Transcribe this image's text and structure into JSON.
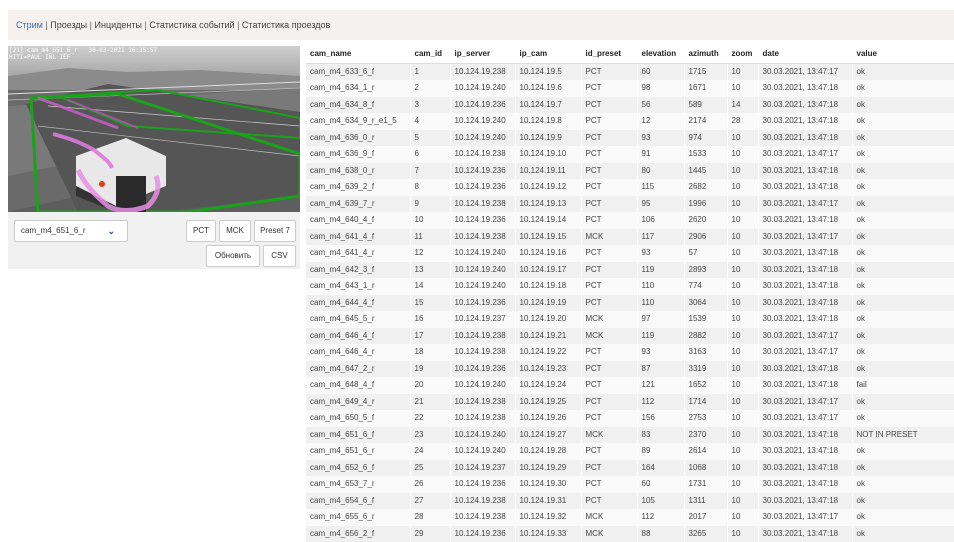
{
  "nav": {
    "links": [
      {
        "label": "Стрим",
        "active": true
      },
      {
        "label": "Проезды",
        "active": false
      },
      {
        "label": "Инциденты",
        "active": false
      },
      {
        "label": "Статистика событий",
        "active": false
      },
      {
        "label": "Статистика проездов",
        "active": false
      }
    ],
    "separator": "|"
  },
  "stream": {
    "osd_line1": "[21] cam_m4_651_6_r   30-03-2021 16:35:57",
    "osd_line2": "HITI=PAUL INL IEF",
    "camera_select_value": "cam_m4_651_6_r",
    "buttons": {
      "pct": "PCT",
      "mck": "MCK",
      "preset7": "Preset 7",
      "refresh": "Обновить",
      "csv": "CSV"
    }
  },
  "table": {
    "columns": [
      "cam_name",
      "cam_id",
      "ip_server",
      "ip_cam",
      "id_preset",
      "elevation",
      "azimuth",
      "zoom",
      "date",
      "value"
    ],
    "rows": [
      [
        "cam_m4_633_6_f",
        "1",
        "10.124.19.238",
        "10.124.19.5",
        "PCT",
        "60",
        "1715",
        "10",
        "30.03.2021, 13:47:17",
        "ok"
      ],
      [
        "cam_m4_634_1_r",
        "2",
        "10.124.19.240",
        "10.124.19.6",
        "PCT",
        "98",
        "1671",
        "10",
        "30.03.2021, 13:47:18",
        "ok"
      ],
      [
        "cam_m4_634_8_f",
        "3",
        "10.124.19.236",
        "10.124.19.7",
        "PCT",
        "56",
        "589",
        "14",
        "30.03.2021, 13:47:18",
        "ok"
      ],
      [
        "cam_m4_634_9_r_e1_5",
        "4",
        "10.124.19.240",
        "10.124.19.8",
        "PCT",
        "12",
        "2174",
        "28",
        "30.03.2021, 13:47:18",
        "ok"
      ],
      [
        "cam_m4_636_0_r",
        "5",
        "10.124.19.240",
        "10.124.19.9",
        "PCT",
        "93",
        "974",
        "10",
        "30.03.2021, 13:47:18",
        "ok"
      ],
      [
        "cam_m4_636_9_f",
        "6",
        "10.124.19.238",
        "10.124.19.10",
        "PCT",
        "91",
        "1533",
        "10",
        "30.03.2021, 13:47:17",
        "ok"
      ],
      [
        "cam_m4_638_0_r",
        "7",
        "10.124.19.236",
        "10.124.19.11",
        "PCT",
        "80",
        "1445",
        "10",
        "30.03.2021, 13:47:18",
        "ok"
      ],
      [
        "cam_m4_639_2_f",
        "8",
        "10.124.19.236",
        "10.124.19.12",
        "PCT",
        "115",
        "2682",
        "10",
        "30.03.2021, 13:47:18",
        "ok"
      ],
      [
        "cam_m4_639_7_r",
        "9",
        "10.124.19.238",
        "10.124.19.13",
        "PCT",
        "95",
        "1996",
        "10",
        "30.03.2021, 13:47:17",
        "ok"
      ],
      [
        "cam_m4_640_4_f",
        "10",
        "10.124.19.236",
        "10.124.19.14",
        "PCT",
        "106",
        "2620",
        "10",
        "30.03.2021, 13:47:18",
        "ok"
      ],
      [
        "cam_m4_641_4_f",
        "11",
        "10.124.19.238",
        "10.124.19.15",
        "MCK",
        "117",
        "2906",
        "10",
        "30.03.2021, 13:47:17",
        "ok"
      ],
      [
        "cam_m4_641_4_r",
        "12",
        "10.124.19.240",
        "10.124.19.16",
        "PCT",
        "93",
        "57",
        "10",
        "30.03.2021, 13:47:18",
        "ok"
      ],
      [
        "cam_m4_642_3_f",
        "13",
        "10.124.19.240",
        "10.124.19.17",
        "PCT",
        "119",
        "2893",
        "10",
        "30.03.2021, 13:47:18",
        "ok"
      ],
      [
        "cam_m4_643_1_r",
        "14",
        "10.124.19.240",
        "10.124.19.18",
        "PCT",
        "110",
        "774",
        "10",
        "30.03.2021, 13:47:18",
        "ok"
      ],
      [
        "cam_m4_644_4_f",
        "15",
        "10.124.19.236",
        "10.124.19.19",
        "PCT",
        "110",
        "3064",
        "10",
        "30.03.2021, 13:47:18",
        "ok"
      ],
      [
        "cam_m4_645_5_r",
        "16",
        "10.124.19.237",
        "10.124.19.20",
        "MCK",
        "97",
        "1539",
        "10",
        "30.03.2021, 13:47:18",
        "ok"
      ],
      [
        "cam_m4_646_4_f",
        "17",
        "10.124.19.238",
        "10.124.19.21",
        "MCK",
        "119",
        "2882",
        "10",
        "30.03.2021, 13:47:17",
        "ok"
      ],
      [
        "cam_m4_646_4_r",
        "18",
        "10.124.19.238",
        "10.124.19.22",
        "PCT",
        "93",
        "3163",
        "10",
        "30.03.2021, 13:47:17",
        "ok"
      ],
      [
        "cam_m4_647_2_r",
        "19",
        "10.124.19.236",
        "10.124.19.23",
        "PCT",
        "87",
        "3319",
        "10",
        "30.03.2021, 13:47:18",
        "ok"
      ],
      [
        "cam_m4_648_4_f",
        "20",
        "10.124.19.240",
        "10.124.19.24",
        "PCT",
        "121",
        "1652",
        "10",
        "30.03.2021, 13:47:18",
        "fail"
      ],
      [
        "cam_m4_649_4_r",
        "21",
        "10.124.19.238",
        "10.124.19.25",
        "PCT",
        "112",
        "1714",
        "10",
        "30.03.2021, 13:47:17",
        "ok"
      ],
      [
        "cam_m4_650_5_f",
        "22",
        "10.124.19.238",
        "10.124.19.26",
        "PCT",
        "156",
        "2753",
        "10",
        "30.03.2021, 13:47:17",
        "ok"
      ],
      [
        "cam_m4_651_6_f",
        "23",
        "10.124.19.240",
        "10.124.19.27",
        "MCK",
        "83",
        "2370",
        "10",
        "30.03.2021, 13:47:18",
        "NOT IN PRESET"
      ],
      [
        "cam_m4_651_6_r",
        "24",
        "10.124.19.240",
        "10.124.19.28",
        "PCT",
        "89",
        "2614",
        "10",
        "30.03.2021, 13:47:18",
        "ok"
      ],
      [
        "cam_m4_652_6_f",
        "25",
        "10.124.19.237",
        "10.124.19.29",
        "PCT",
        "164",
        "1068",
        "10",
        "30.03.2021, 13:47:18",
        "ok"
      ],
      [
        "cam_m4_653_7_r",
        "26",
        "10.124.19.236",
        "10.124.19.30",
        "PCT",
        "60",
        "1731",
        "10",
        "30.03.2021, 13:47:18",
        "ok"
      ],
      [
        "cam_m4_654_6_f",
        "27",
        "10.124.19.238",
        "10.124.19.31",
        "PCT",
        "105",
        "1311",
        "10",
        "30.03.2021, 13:47:18",
        "ok"
      ],
      [
        "cam_m4_655_6_r",
        "28",
        "10.124.19.238",
        "10.124.19.32",
        "MCK",
        "112",
        "2017",
        "10",
        "30.03.2021, 13:47:17",
        "ok"
      ],
      [
        "cam_m4_656_2_f",
        "29",
        "10.124.19.236",
        "10.124.19.33",
        "MCK",
        "88",
        "3265",
        "10",
        "30.03.2021, 13:47:18",
        "ok"
      ]
    ]
  }
}
